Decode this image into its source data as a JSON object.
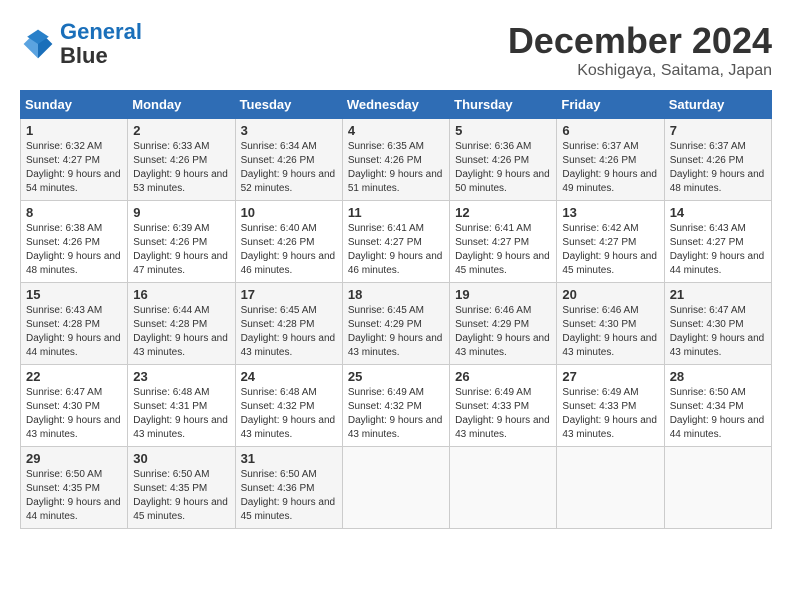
{
  "header": {
    "logo_line1": "General",
    "logo_line2": "Blue",
    "month": "December 2024",
    "location": "Koshigaya, Saitama, Japan"
  },
  "days_of_week": [
    "Sunday",
    "Monday",
    "Tuesday",
    "Wednesday",
    "Thursday",
    "Friday",
    "Saturday"
  ],
  "weeks": [
    [
      {
        "day": "1",
        "sunrise": "Sunrise: 6:32 AM",
        "sunset": "Sunset: 4:27 PM",
        "daylight": "Daylight: 9 hours and 54 minutes."
      },
      {
        "day": "2",
        "sunrise": "Sunrise: 6:33 AM",
        "sunset": "Sunset: 4:26 PM",
        "daylight": "Daylight: 9 hours and 53 minutes."
      },
      {
        "day": "3",
        "sunrise": "Sunrise: 6:34 AM",
        "sunset": "Sunset: 4:26 PM",
        "daylight": "Daylight: 9 hours and 52 minutes."
      },
      {
        "day": "4",
        "sunrise": "Sunrise: 6:35 AM",
        "sunset": "Sunset: 4:26 PM",
        "daylight": "Daylight: 9 hours and 51 minutes."
      },
      {
        "day": "5",
        "sunrise": "Sunrise: 6:36 AM",
        "sunset": "Sunset: 4:26 PM",
        "daylight": "Daylight: 9 hours and 50 minutes."
      },
      {
        "day": "6",
        "sunrise": "Sunrise: 6:37 AM",
        "sunset": "Sunset: 4:26 PM",
        "daylight": "Daylight: 9 hours and 49 minutes."
      },
      {
        "day": "7",
        "sunrise": "Sunrise: 6:37 AM",
        "sunset": "Sunset: 4:26 PM",
        "daylight": "Daylight: 9 hours and 48 minutes."
      }
    ],
    [
      {
        "day": "8",
        "sunrise": "Sunrise: 6:38 AM",
        "sunset": "Sunset: 4:26 PM",
        "daylight": "Daylight: 9 hours and 48 minutes."
      },
      {
        "day": "9",
        "sunrise": "Sunrise: 6:39 AM",
        "sunset": "Sunset: 4:26 PM",
        "daylight": "Daylight: 9 hours and 47 minutes."
      },
      {
        "day": "10",
        "sunrise": "Sunrise: 6:40 AM",
        "sunset": "Sunset: 4:26 PM",
        "daylight": "Daylight: 9 hours and 46 minutes."
      },
      {
        "day": "11",
        "sunrise": "Sunrise: 6:41 AM",
        "sunset": "Sunset: 4:27 PM",
        "daylight": "Daylight: 9 hours and 46 minutes."
      },
      {
        "day": "12",
        "sunrise": "Sunrise: 6:41 AM",
        "sunset": "Sunset: 4:27 PM",
        "daylight": "Daylight: 9 hours and 45 minutes."
      },
      {
        "day": "13",
        "sunrise": "Sunrise: 6:42 AM",
        "sunset": "Sunset: 4:27 PM",
        "daylight": "Daylight: 9 hours and 45 minutes."
      },
      {
        "day": "14",
        "sunrise": "Sunrise: 6:43 AM",
        "sunset": "Sunset: 4:27 PM",
        "daylight": "Daylight: 9 hours and 44 minutes."
      }
    ],
    [
      {
        "day": "15",
        "sunrise": "Sunrise: 6:43 AM",
        "sunset": "Sunset: 4:28 PM",
        "daylight": "Daylight: 9 hours and 44 minutes."
      },
      {
        "day": "16",
        "sunrise": "Sunrise: 6:44 AM",
        "sunset": "Sunset: 4:28 PM",
        "daylight": "Daylight: 9 hours and 43 minutes."
      },
      {
        "day": "17",
        "sunrise": "Sunrise: 6:45 AM",
        "sunset": "Sunset: 4:28 PM",
        "daylight": "Daylight: 9 hours and 43 minutes."
      },
      {
        "day": "18",
        "sunrise": "Sunrise: 6:45 AM",
        "sunset": "Sunset: 4:29 PM",
        "daylight": "Daylight: 9 hours and 43 minutes."
      },
      {
        "day": "19",
        "sunrise": "Sunrise: 6:46 AM",
        "sunset": "Sunset: 4:29 PM",
        "daylight": "Daylight: 9 hours and 43 minutes."
      },
      {
        "day": "20",
        "sunrise": "Sunrise: 6:46 AM",
        "sunset": "Sunset: 4:30 PM",
        "daylight": "Daylight: 9 hours and 43 minutes."
      },
      {
        "day": "21",
        "sunrise": "Sunrise: 6:47 AM",
        "sunset": "Sunset: 4:30 PM",
        "daylight": "Daylight: 9 hours and 43 minutes."
      }
    ],
    [
      {
        "day": "22",
        "sunrise": "Sunrise: 6:47 AM",
        "sunset": "Sunset: 4:30 PM",
        "daylight": "Daylight: 9 hours and 43 minutes."
      },
      {
        "day": "23",
        "sunrise": "Sunrise: 6:48 AM",
        "sunset": "Sunset: 4:31 PM",
        "daylight": "Daylight: 9 hours and 43 minutes."
      },
      {
        "day": "24",
        "sunrise": "Sunrise: 6:48 AM",
        "sunset": "Sunset: 4:32 PM",
        "daylight": "Daylight: 9 hours and 43 minutes."
      },
      {
        "day": "25",
        "sunrise": "Sunrise: 6:49 AM",
        "sunset": "Sunset: 4:32 PM",
        "daylight": "Daylight: 9 hours and 43 minutes."
      },
      {
        "day": "26",
        "sunrise": "Sunrise: 6:49 AM",
        "sunset": "Sunset: 4:33 PM",
        "daylight": "Daylight: 9 hours and 43 minutes."
      },
      {
        "day": "27",
        "sunrise": "Sunrise: 6:49 AM",
        "sunset": "Sunset: 4:33 PM",
        "daylight": "Daylight: 9 hours and 43 minutes."
      },
      {
        "day": "28",
        "sunrise": "Sunrise: 6:50 AM",
        "sunset": "Sunset: 4:34 PM",
        "daylight": "Daylight: 9 hours and 44 minutes."
      }
    ],
    [
      {
        "day": "29",
        "sunrise": "Sunrise: 6:50 AM",
        "sunset": "Sunset: 4:35 PM",
        "daylight": "Daylight: 9 hours and 44 minutes."
      },
      {
        "day": "30",
        "sunrise": "Sunrise: 6:50 AM",
        "sunset": "Sunset: 4:35 PM",
        "daylight": "Daylight: 9 hours and 45 minutes."
      },
      {
        "day": "31",
        "sunrise": "Sunrise: 6:50 AM",
        "sunset": "Sunset: 4:36 PM",
        "daylight": "Daylight: 9 hours and 45 minutes."
      },
      null,
      null,
      null,
      null
    ]
  ]
}
